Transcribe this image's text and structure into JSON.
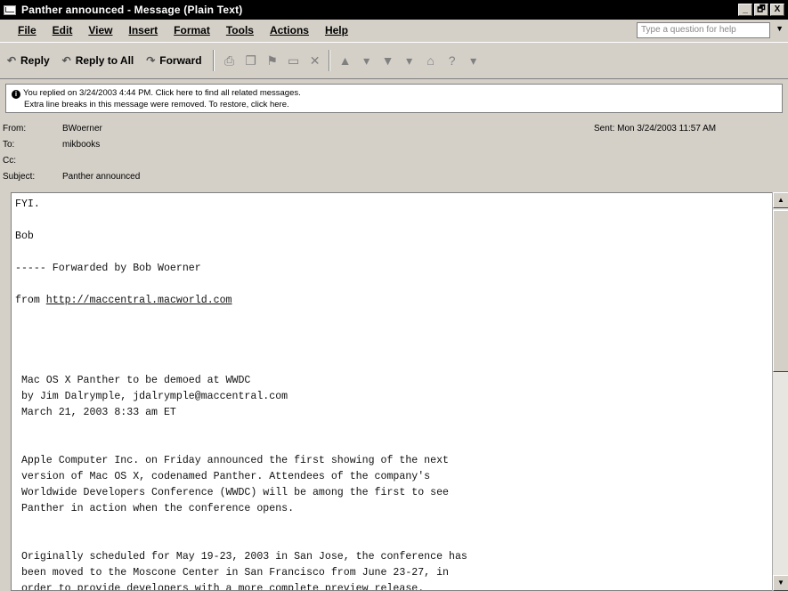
{
  "window": {
    "title": "Panther announced - Message (Plain Text)",
    "controls": [
      "_",
      "🗗",
      "X"
    ]
  },
  "menubar": {
    "items": [
      "File",
      "Edit",
      "View",
      "Insert",
      "Format",
      "Tools",
      "Actions",
      "Help"
    ],
    "help_placeholder": "Type a question for help"
  },
  "toolbar": {
    "reply": "Reply",
    "reply_all": "Reply to All",
    "forward": "Forward"
  },
  "infobar": {
    "line1": "You replied on 3/24/2003 4:44 PM. Click here to find all related messages.",
    "line2": "Extra line breaks in this message were removed. To restore, click here."
  },
  "headers": {
    "from_label": "From:",
    "from": "BWoerner",
    "to_label": "To:",
    "to": "mikbooks",
    "cc_label": "Cc:",
    "cc": "",
    "subject_label": "Subject:",
    "subject": "Panther announced",
    "sent": "Sent:  Mon 3/24/2003 11:57 AM"
  },
  "message": {
    "line01": "FYI.",
    "line02": "Bob",
    "line03": "----- Forwarded by Bob Woerner",
    "line04_prefix": "from ",
    "line04_link": "http://maccentral.macworld.com",
    "line05": " Mac OS X Panther to be demoed at WWDC",
    "line06": " by Jim Dalrymple, jdalrymple@maccentral.com",
    "line07": " March 21, 2003 8:33 am ET",
    "line08": " Apple Computer Inc. on Friday announced the first showing of the next",
    "line09": " version of Mac OS X, codenamed Panther. Attendees of the company's",
    "line10": " Worldwide Developers Conference (WWDC) will be among the first to see",
    "line11": " Panther in action when the conference opens.",
    "line12": " Originally scheduled for May 19-23, 2003 in San Jose, the conference has",
    "line13": " been moved to the Moscone Center in San Francisco from June 23-27, in",
    "line14": " order to provide developers with a more complete preview release."
  }
}
